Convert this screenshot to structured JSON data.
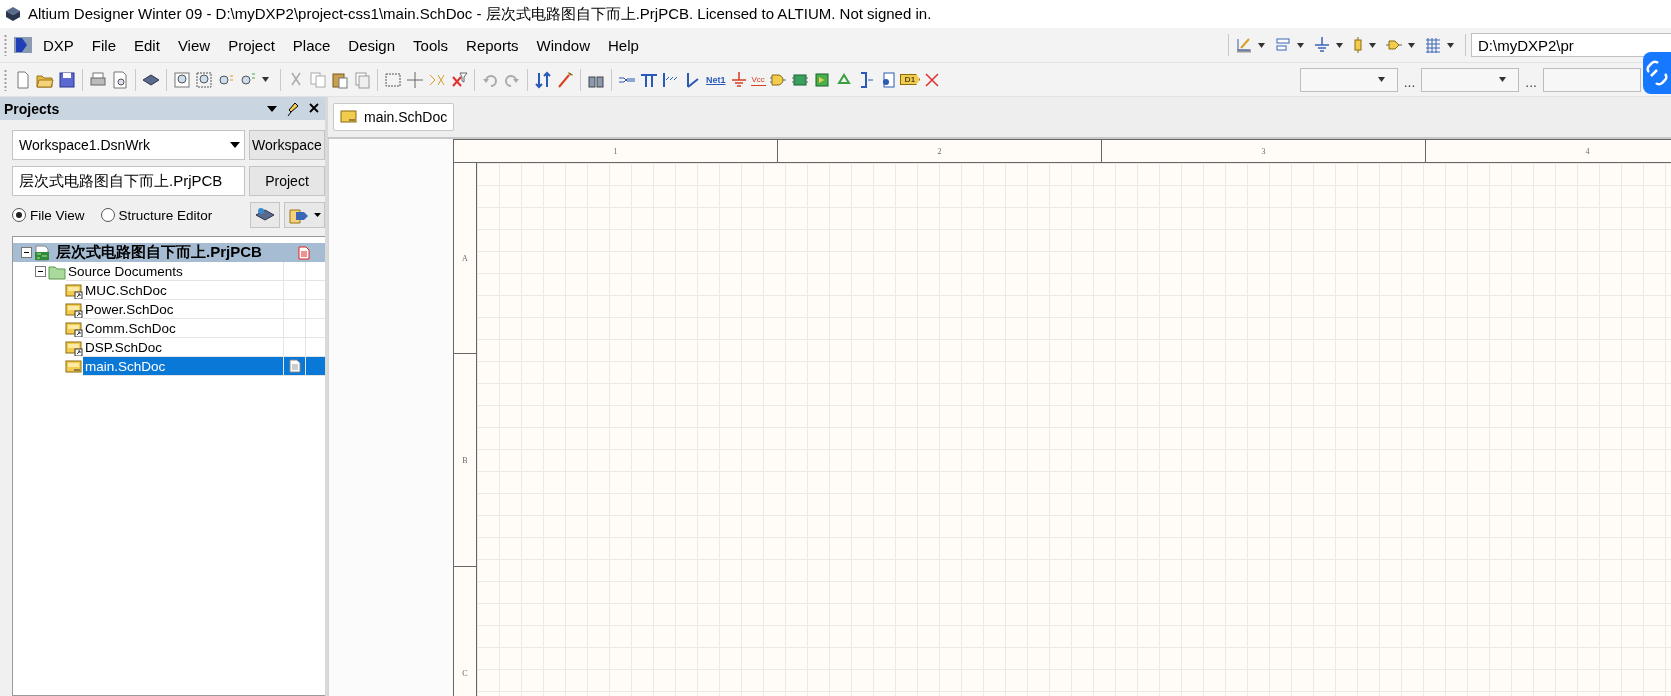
{
  "window": {
    "title": "Altium Designer Winter 09 - D:\\myDXP2\\project-css1\\main.SchDoc - 层次式电路图自下而上.PrjPCB. Licensed to ALTIUM. Not signed in."
  },
  "menu": [
    {
      "label": "DXP"
    },
    {
      "label": "File"
    },
    {
      "label": "Edit"
    },
    {
      "label": "View"
    },
    {
      "label": "Project"
    },
    {
      "label": "Place"
    },
    {
      "label": "Design"
    },
    {
      "label": "Tools"
    },
    {
      "label": "Reports"
    },
    {
      "label": "Window"
    },
    {
      "label": "Help"
    }
  ],
  "toolbar": {
    "net_label": "Net1",
    "power_port": "Vcc",
    "port_label": "D1"
  },
  "path_field": {
    "value": "D:\\myDXP2\\pr"
  },
  "filter_combo_separators": [
    "...",
    "..."
  ],
  "projects_panel": {
    "title": "Projects",
    "workspace_combo": {
      "value": "Workspace1.DsnWrk"
    },
    "workspace_button": "Workspace",
    "project_field": {
      "value": "层次式电路图自下而上.PrjPCB"
    },
    "project_button": "Project",
    "views": [
      {
        "label": "File View",
        "selected": true
      },
      {
        "label": "Structure Editor",
        "selected": false
      }
    ],
    "tree": [
      {
        "label": "层次式电路图自下而上.PrjPCB",
        "kind": "project",
        "expanded": true,
        "active": true,
        "selected": false,
        "children": [
          {
            "label": "Source Documents",
            "kind": "folder",
            "expanded": true,
            "selected": false,
            "children": [
              {
                "label": "MUC.SchDoc",
                "kind": "sheet",
                "linked": true,
                "open": false,
                "selected": false
              },
              {
                "label": "Power.SchDoc",
                "kind": "sheet",
                "linked": true,
                "open": false,
                "selected": false
              },
              {
                "label": "Comm.SchDoc",
                "kind": "sheet",
                "linked": true,
                "open": false,
                "selected": false
              },
              {
                "label": "DSP.SchDoc",
                "kind": "sheet",
                "linked": true,
                "open": false,
                "selected": false
              },
              {
                "label": "main.SchDoc",
                "kind": "sheet",
                "linked": false,
                "open": true,
                "selected": true
              }
            ]
          }
        ]
      }
    ]
  },
  "document_tabs": [
    {
      "label": "main.SchDoc",
      "selected": true
    }
  ],
  "sheet": {
    "columns": [
      "1",
      "2",
      "3",
      "4"
    ],
    "rows": [
      "A",
      "B",
      "C"
    ]
  }
}
